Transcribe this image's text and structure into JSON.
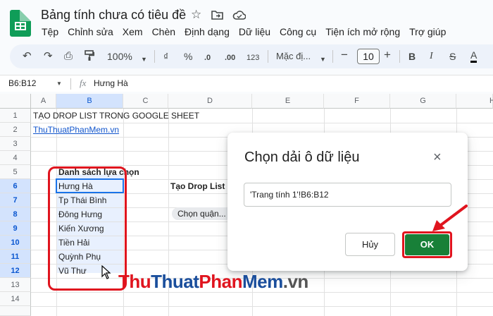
{
  "app": {
    "doc_title": "Bảng tính chưa có tiêu đề",
    "title_icons": [
      "star-icon",
      "move-to-folder-icon",
      "cloud-icon"
    ]
  },
  "menu": [
    "Tệp",
    "Chỉnh sửa",
    "Xem",
    "Chèn",
    "Định dạng",
    "Dữ liệu",
    "Công cụ",
    "Tiện ích mở rộng",
    "Trợ giúp"
  ],
  "toolbar": {
    "undo": "↶",
    "redo": "↷",
    "print": "⎙",
    "paint": "🖌",
    "zoom": "100%",
    "currency": "₫",
    "percent": "%",
    "dec_less": ".0",
    "dec_more": ".00",
    "num_format": "123",
    "font": "Mặc đị...",
    "minus": "−",
    "font_size": "10",
    "plus": "+",
    "bold": "B",
    "italic": "I",
    "strike": "S",
    "text_color": "A"
  },
  "formula_bar": {
    "name_box": "B6:B12",
    "fx": "fx",
    "value": "Hưng Hà"
  },
  "columns": [
    "A",
    "B",
    "C",
    "D",
    "E",
    "F",
    "G",
    "H"
  ],
  "rows": [
    "1",
    "2",
    "3",
    "4",
    "5",
    "6",
    "7",
    "8",
    "9",
    "10",
    "11",
    "12",
    "13",
    "14"
  ],
  "cells": {
    "a1": "TẠO DROP LIST TRONG GOOGLE SHEET",
    "a2": "ThuThuatPhanMem.vn",
    "b5": "Danh sách lựa chọn",
    "b6": "Hưng Hà",
    "b7": "Tp Thái Bình",
    "b8": "Đông Hưng",
    "b9": "Kiến Xương",
    "b10": "Tiền Hải",
    "b11": "Quỳnh Phụ",
    "b12": "Vũ Thư",
    "d6": "Tạo Drop List",
    "d8": "Chọn quận..."
  },
  "dialog": {
    "title": "Chọn dải ô dữ liệu",
    "close": "×",
    "range_value": "'Trang tính 1'!B6:B12",
    "cancel_label": "Hủy",
    "ok_label": "OK"
  },
  "watermark": {
    "part1": "Thu",
    "part2": "Thuat",
    "part3": "Phan",
    "part4": "Mem",
    "part5": ".vn"
  },
  "colors": {
    "accent": "#1a73e8",
    "ok_green": "#188038",
    "annotation_red": "#e0141e"
  }
}
